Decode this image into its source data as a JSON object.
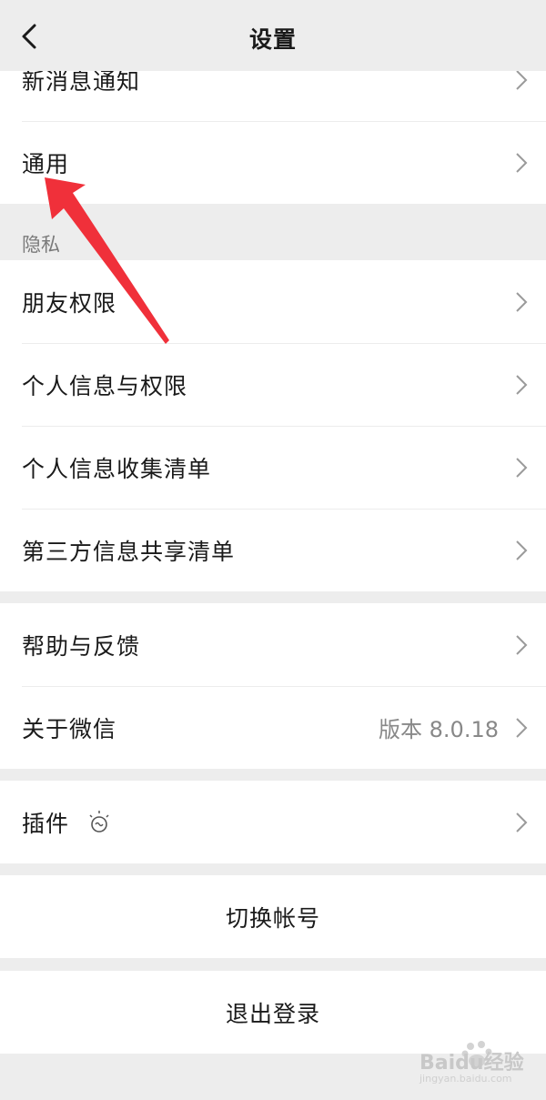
{
  "nav": {
    "title": "设置",
    "back_icon": "chevron-left-icon"
  },
  "group_top": {
    "items": [
      {
        "label": "新消息通知"
      },
      {
        "label": "通用"
      }
    ]
  },
  "privacy": {
    "header": "隐私",
    "items": [
      {
        "label": "朋友权限"
      },
      {
        "label": "个人信息与权限"
      },
      {
        "label": "个人信息收集清单"
      },
      {
        "label": "第三方信息共享清单"
      }
    ]
  },
  "about_group": {
    "items": [
      {
        "label": "帮助与反馈"
      },
      {
        "label": "关于微信",
        "value": "版本 8.0.18"
      }
    ]
  },
  "plugins": {
    "label": "插件",
    "icon": "lightbulb-icon"
  },
  "actions": {
    "switch_account": "切换帐号",
    "logout": "退出登录"
  },
  "annotation": {
    "arrow_color": "#f0303a"
  },
  "watermark": {
    "text": "Baidu经验",
    "sub": "jingyan.baidu.com"
  }
}
